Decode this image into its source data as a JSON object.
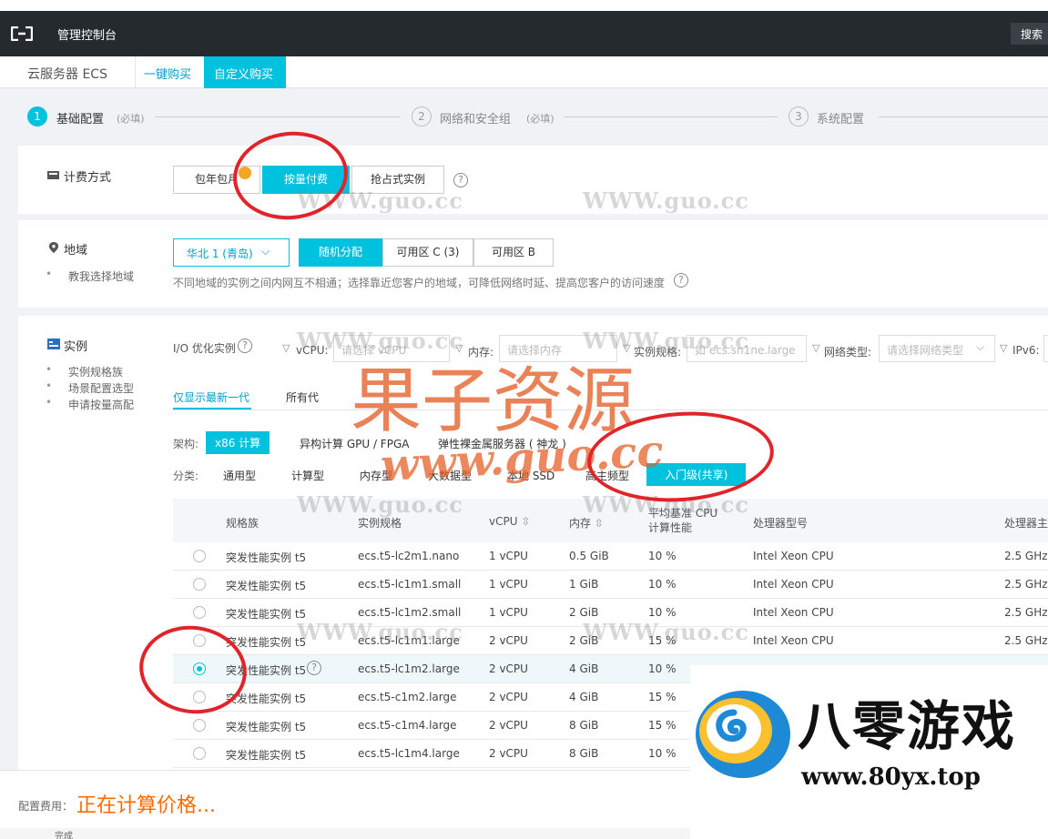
{
  "topbar": {
    "title": "管理控制台",
    "search_label": "搜索"
  },
  "tabs": {
    "product": "云服务器 ECS",
    "quick_buy": "一键购买",
    "custom_buy": "自定义购买"
  },
  "steps": [
    {
      "num": "1",
      "label": "基础配置",
      "sub": "(必填)"
    },
    {
      "num": "2",
      "label": "网络和安全组",
      "sub": "(必填)"
    },
    {
      "num": "3",
      "label": "系统配置",
      "sub": ""
    }
  ],
  "billing": {
    "title": "计费方式",
    "options": [
      "包年包月",
      "按量付费",
      "抢占式实例"
    ],
    "selected": "按量付费",
    "help": "?"
  },
  "region": {
    "title": "地域",
    "guide_link": "教我选择地域",
    "region_value": "华北 1 (青岛)",
    "zones": [
      "随机分配",
      "可用区 C (3)",
      "可用区 B"
    ],
    "selected_zone": "随机分配",
    "hint": "不同地域的实例之间内网互不相通；选择靠近您客户的地域，可降低网络时延、提高您客户的访问速度",
    "help": "?"
  },
  "instance": {
    "title": "实例",
    "links": [
      "实例规格族",
      "场景配置选型",
      "申请按量高配"
    ],
    "filters": {
      "io_label": "I/O 优化实例",
      "vcpu_label": "vCPU:",
      "vcpu_placeholder": "请选择 vCPU",
      "memory_label": "内存:",
      "memory_placeholder": "请选择内存",
      "spec_label": "实例规格:",
      "spec_placeholder": "如 ecs.sn1ne.large",
      "network_label": "网络类型:",
      "network_placeholder": "请选择网络类型",
      "ipv6_label": "IPv6:"
    },
    "generation_tabs": [
      "仅显示最新一代",
      "所有代"
    ],
    "arch_label": "架构:",
    "arch_options": [
      "x86 计算",
      "异构计算 GPU / FPGA",
      "弹性裸金属服务器 ( 神龙 )"
    ],
    "category_label": "分类:",
    "category_options": [
      "通用型",
      "计算型",
      "内存型",
      "大数据型",
      "本地 SSD",
      "高主频型",
      "入门级(共享)"
    ],
    "table": {
      "headers": [
        "规格族",
        "实例规格",
        "vCPU",
        "内存",
        "平均基准 CPU 计算性能",
        "处理器型号",
        "处理器主"
      ],
      "rows": [
        {
          "family": "突发性能实例 t5",
          "spec": "ecs.t5-lc2m1.nano",
          "vcpu": "1 vCPU",
          "mem": "0.5 GiB",
          "perf": "10 %",
          "cpu": "Intel Xeon CPU",
          "freq": "2.5 GHz",
          "selected": false
        },
        {
          "family": "突发性能实例 t5",
          "spec": "ecs.t5-lc1m1.small",
          "vcpu": "1 vCPU",
          "mem": "1 GiB",
          "perf": "10 %",
          "cpu": "Intel Xeon CPU",
          "freq": "2.5 GHz",
          "selected": false
        },
        {
          "family": "突发性能实例 t5",
          "spec": "ecs.t5-lc1m2.small",
          "vcpu": "1 vCPU",
          "mem": "2 GiB",
          "perf": "10 %",
          "cpu": "Intel Xeon CPU",
          "freq": "2.5 GHz",
          "selected": false
        },
        {
          "family": "突发性能实例 t5",
          "spec": "ecs.t5-lc1m1.large",
          "vcpu": "2 vCPU",
          "mem": "2 GiB",
          "perf": "15 %",
          "cpu": "Intel Xeon CPU",
          "freq": "2.5 GHz",
          "selected": false
        },
        {
          "family": "突发性能实例 t5",
          "spec": "ecs.t5-lc1m2.large",
          "vcpu": "2 vCPU",
          "mem": "4 GiB",
          "perf": "10 %",
          "cpu": "",
          "freq": "",
          "selected": true
        },
        {
          "family": "突发性能实例 t5",
          "spec": "ecs.t5-c1m2.large",
          "vcpu": "2 vCPU",
          "mem": "4 GiB",
          "perf": "15 %",
          "cpu": "",
          "freq": "",
          "selected": false
        },
        {
          "family": "突发性能实例 t5",
          "spec": "ecs.t5-c1m4.large",
          "vcpu": "2 vCPU",
          "mem": "8 GiB",
          "perf": "15 %",
          "cpu": "",
          "freq": "",
          "selected": false
        },
        {
          "family": "突发性能实例 t5",
          "spec": "ecs.t5-lc1m4.large",
          "vcpu": "2 vCPU",
          "mem": "8 GiB",
          "perf": "10 %",
          "cpu": "",
          "freq": "",
          "selected": false
        }
      ]
    }
  },
  "footer": {
    "cost_label": "配置费用：",
    "cost_value": "正在计算价格..."
  },
  "bottom_strip": "完成",
  "watermarks": {
    "url": "WWW.guo.cc",
    "big_text": "果子资源",
    "big_url": "www.guo.cc"
  },
  "ad": {
    "title": "八零游戏",
    "url": "www.80yx.top"
  },
  "colors": {
    "accent": "#00c1de",
    "price": "#ff6a00",
    "topbar": "#252a2f",
    "ring": "#e0242a"
  }
}
